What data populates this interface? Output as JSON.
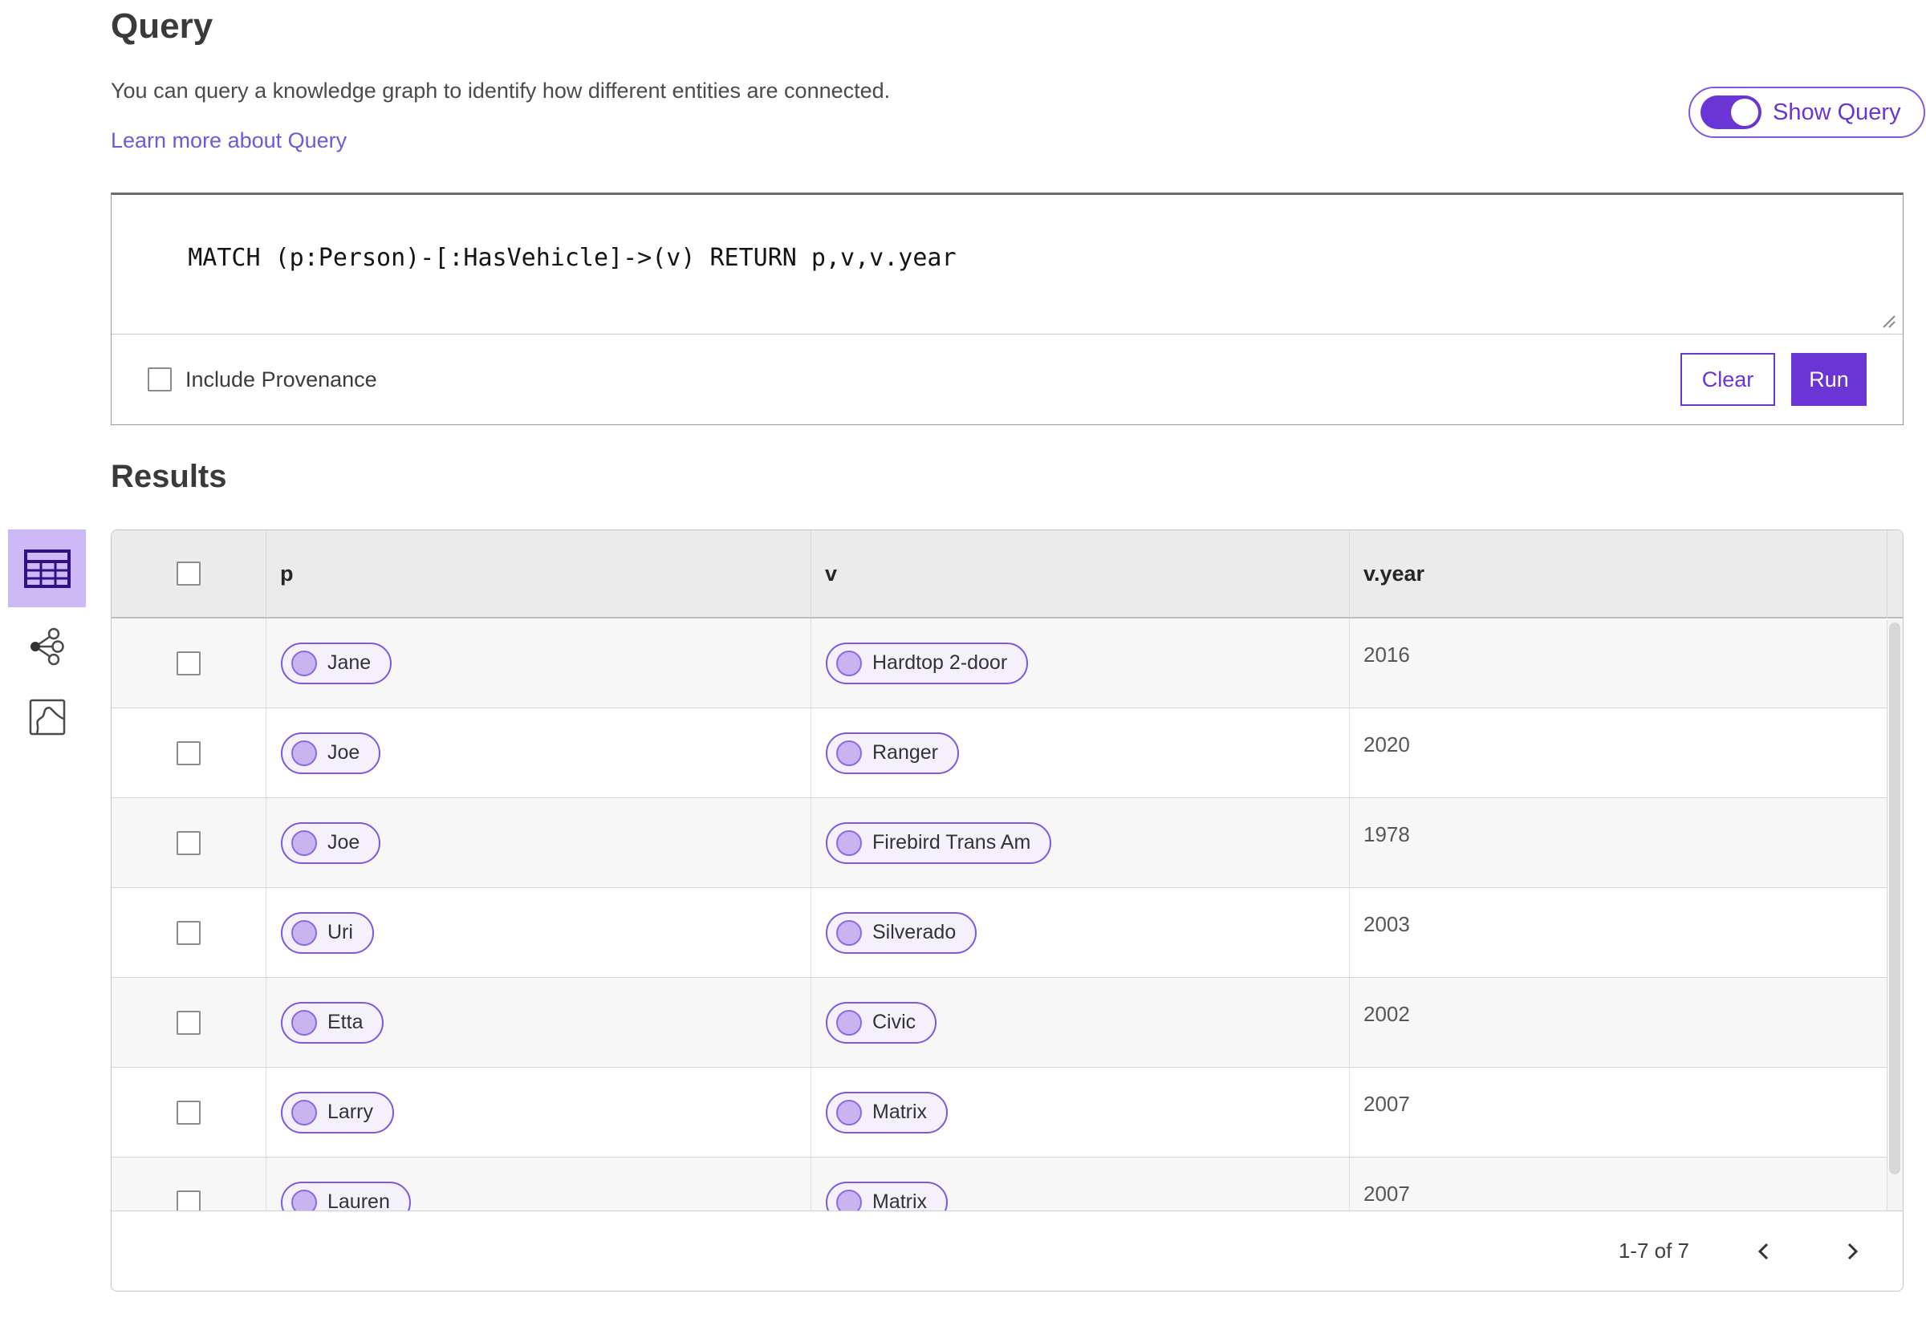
{
  "header": {
    "title": "Query",
    "description": "You can query a knowledge graph to identify how different entities are connected.",
    "learn_more": "Learn more about Query",
    "show_query_label": "Show Query",
    "show_query_enabled": true
  },
  "query_panel": {
    "query_text": "MATCH (p:Person)-[:HasVehicle]->(v) RETURN p,v,v.year",
    "include_provenance_label": "Include Provenance",
    "include_provenance_checked": false,
    "clear_label": "Clear",
    "run_label": "Run"
  },
  "results": {
    "title": "Results",
    "views": [
      {
        "name": "table-view",
        "active": true
      },
      {
        "name": "graph-view",
        "active": false
      },
      {
        "name": "map-view",
        "active": false
      }
    ],
    "table": {
      "columns": [
        "p",
        "v",
        "v.year"
      ],
      "rows": [
        {
          "p": "Jane",
          "v": "Hardtop 2-door",
          "v_year": "2016"
        },
        {
          "p": "Joe",
          "v": "Ranger",
          "v_year": "2020"
        },
        {
          "p": "Joe",
          "v": "Firebird Trans Am",
          "v_year": "1978"
        },
        {
          "p": "Uri",
          "v": "Silverado",
          "v_year": "2003"
        },
        {
          "p": "Etta",
          "v": "Civic",
          "v_year": "2002"
        },
        {
          "p": "Larry",
          "v": "Matrix",
          "v_year": "2007"
        },
        {
          "p": "Lauren",
          "v": "Matrix",
          "v_year": "2007"
        }
      ]
    },
    "pagination": {
      "range": "1-7 of 7"
    }
  },
  "colors": {
    "primary_purple": "#6a35d4",
    "pill_border": "#7e57e4",
    "pill_background": "#f4f1fc",
    "pill_dot": "#cab4f0",
    "selected_view_background": "#ccb9f6",
    "link": "#6c5bd9",
    "table_header_background": "#ebebeb",
    "row_alt_background": "#f7f7f7"
  }
}
